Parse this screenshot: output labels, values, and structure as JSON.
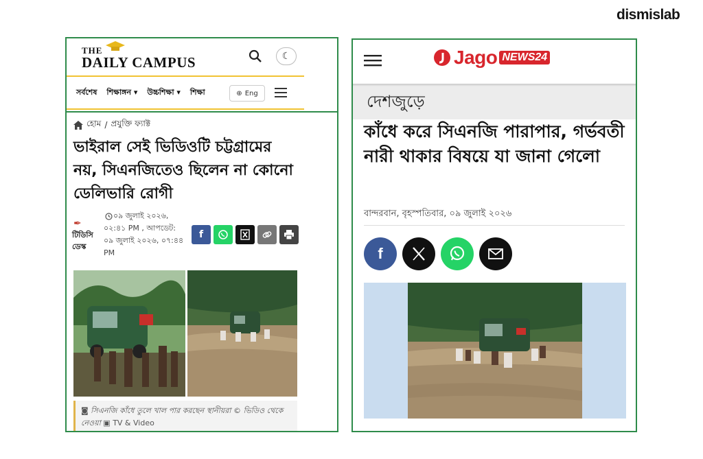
{
  "brand": "dismislab",
  "left_site": {
    "logo_the": "THE",
    "logo_name": "DAILY CAMPUS",
    "nav": [
      "সর্বশেষ",
      "শিক্ষাঙ্গন ▾",
      "উচ্চশিক্ষা ▾",
      "শিক্ষা"
    ],
    "lang_label": "Eng",
    "breadcrumb": [
      "হোম",
      "/",
      "প্রযুক্তি ফ্যাক্ট"
    ],
    "title": "ভাইরাল সেই ভিডিওটি চট্টগ্রামের নয়, সিএনজিতেও ছিলেন না কোনো ডেলিভারি রোগী",
    "author": "টিডিসি ডেস্ক",
    "published": "০৯ জুলাই ২০২৬, ০২:৪১ PM , আপডেট: ০৯ জুলাই ২০২৬, ০৭:৪৪ PM",
    "caption": "সিএনজি কাঁধে তুলে খাল পার করছেন স্থানীয়রা © ভিডিও থেকে নেওয়া",
    "caption_source": "TV & Video"
  },
  "right_site": {
    "logo_word": "Jago",
    "logo_badge": "NEWS24",
    "category": "দেশজুড়ে",
    "title": "কাঁধে করে সিএনজি পারাপার, গর্ভবতী নারী থাকার বিষয়ে যা জানা গেলো",
    "meta": "বান্দরবান, বৃহস্পতিবার, ০৯ জুলাই ২০২৬"
  },
  "colors": {
    "panel_border": "#2e8b4a",
    "dc_accent": "#f1c232",
    "jago_red": "#d8262d",
    "facebook": "#3b5998",
    "whatsapp": "#25d366"
  }
}
